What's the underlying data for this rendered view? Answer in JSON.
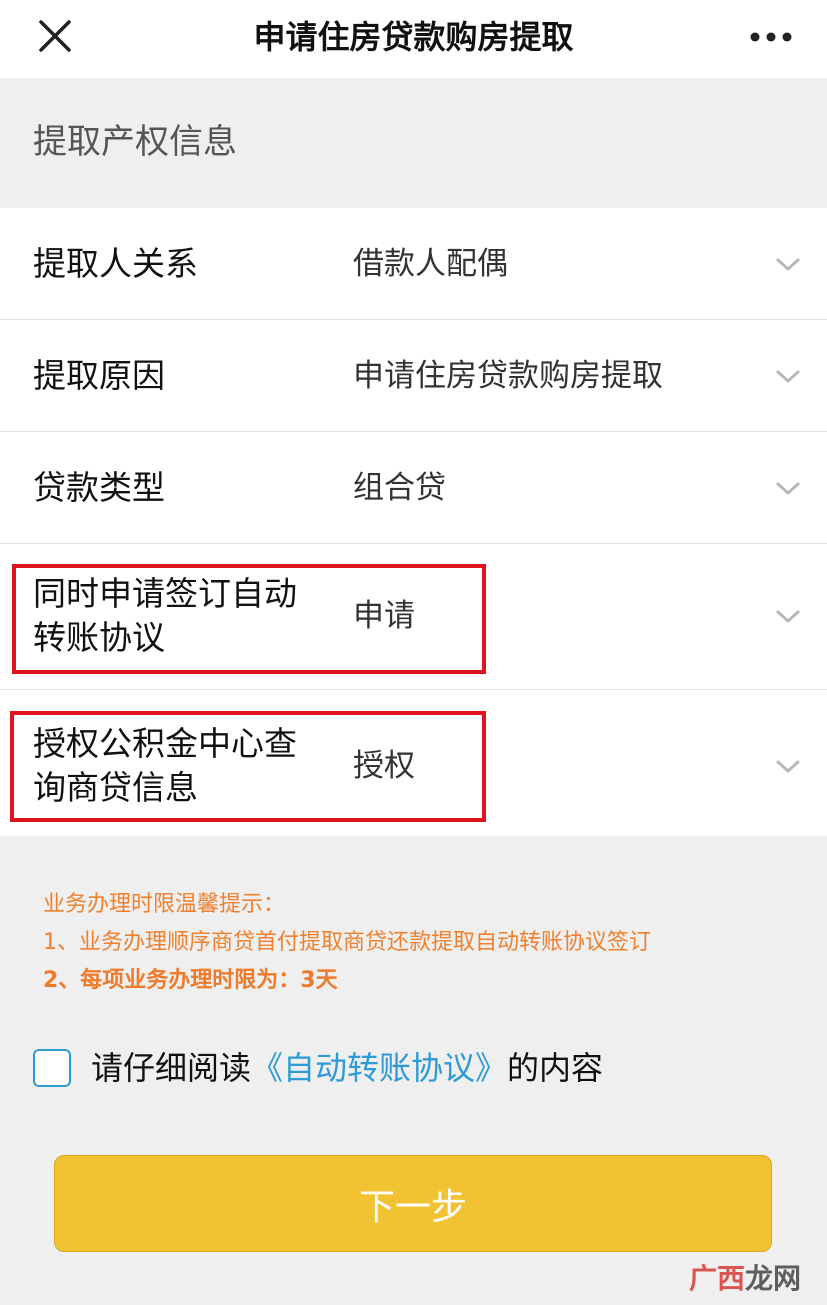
{
  "header": {
    "title": "申请住房贷款购房提取",
    "close_icon": "close-icon",
    "more_icon": "more-dots-icon"
  },
  "section": {
    "title": "提取产权信息"
  },
  "form": {
    "rows": [
      {
        "label": "提取人关系",
        "value": "借款人配偶"
      },
      {
        "label": "提取原因",
        "value": "申请住房贷款购房提取"
      },
      {
        "label": "贷款类型",
        "value": "组合贷"
      },
      {
        "label_line1": "同时申请签订自动",
        "label_line2": "转账协议",
        "value": "申请"
      },
      {
        "label_line1": "授权公积金中心查",
        "label_line2": "询商贷信息",
        "value": "授权"
      }
    ]
  },
  "tips": {
    "title": "业务办理时限温馨提示：",
    "line1": "1、业务办理顺序商贷首付提取商贷还款提取自动转账协议签订",
    "line2": "2、每项业务办理时限为：3天"
  },
  "agreement": {
    "prefix": "请仔细阅读",
    "link": "《自动转账协议》",
    "suffix": "的内容",
    "checked": false
  },
  "next_button": {
    "label": "下一步"
  },
  "watermark": {
    "part1": "广西",
    "part2": "龙网"
  },
  "colors": {
    "accent_yellow": "#f1c232",
    "link_blue": "#2e9ad6",
    "tip_orange": "#f0802e",
    "highlight_red": "#e0141e"
  }
}
